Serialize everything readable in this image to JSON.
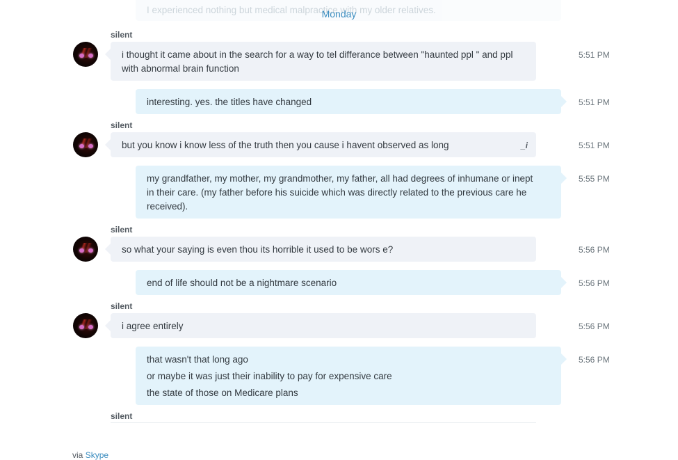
{
  "previous_message": {
    "text": "I experienced nothing but medical malpractice with my older relatives."
  },
  "day_separator": "Monday",
  "messages": [
    {
      "sender": "silent",
      "lines": [
        "i thought it came about in the search for a way to tel differance between \"haunted ppl \" and ppl",
        "with abnormal brain function"
      ],
      "time": "5:51 PM"
    },
    {
      "lines": [
        "interesting.  yes.  the titles have changed"
      ],
      "time": "5:51 PM"
    },
    {
      "sender": "silent",
      "lines": [
        "but  you know i know less of the truth then you cause i havent observed as long"
      ],
      "time": "5:51 PM",
      "edited_mark": "_i"
    },
    {
      "lines": [
        "my grandfather, my mother, my grandmother, my father, all had degrees of inhumane or inept",
        "in their care.  (my father before his suicide which was directly related to the previous care he",
        "received)."
      ],
      "time": "5:55 PM"
    },
    {
      "sender": "silent",
      "lines": [
        "so what your saying is even thou its horrible it used to be wors e?"
      ],
      "time": "5:56 PM"
    },
    {
      "lines": [
        "end of life should not be a nightmare scenario"
      ],
      "time": "5:56 PM"
    },
    {
      "sender": "silent",
      "lines": [
        "i agree entirely"
      ],
      "time": "5:56 PM"
    },
    {
      "lines": [
        "that wasn't that long ago",
        "or maybe it was just their inability to pay for expensive care",
        "the state of those on Medicare plans"
      ],
      "time": "5:56 PM"
    }
  ],
  "next_sender": "silent",
  "footer": {
    "prefix": "via",
    "link": "Skype"
  }
}
